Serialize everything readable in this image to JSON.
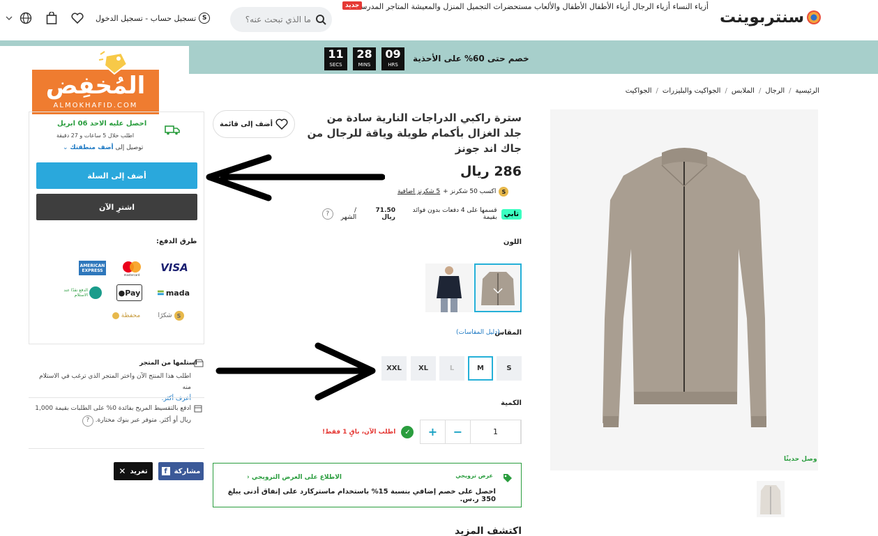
{
  "header": {
    "logo_text": "سنتربوينت",
    "new_badge": "جديد",
    "categories_line": "أزياء النساء أزياء الرجال أزياء الأطفال الأطفال والألعاب مستحضرات التجميل المنزل والمعيشة المتاجر المدرسة",
    "search_placeholder": "ما الذي تبحث عنه؟",
    "signin_label": "تسجيل حساب - تسجيل الدخول",
    "shukran_symbol": "S"
  },
  "promo": {
    "text": "خصم حتى 60% على الأحذية",
    "timer": [
      {
        "value": "09",
        "unit": "HRS"
      },
      {
        "value": "28",
        "unit": "MINS"
      },
      {
        "value": "11",
        "unit": "SECS"
      }
    ]
  },
  "watermark": {
    "arabic": "المُخفِض",
    "latin": "ALMOKHAFID.COM"
  },
  "breadcrumb": [
    "الرئيسية",
    "الرجال",
    "الملابس",
    "الجواكيت والبليزرات",
    "الجواكيت"
  ],
  "breadcrumb_sep": "/",
  "product": {
    "title": "سترة راكبي الدراجات النارية سادة من جلد الغزال بأكمام طويلة وياقة للرجال من جاك اند جونز",
    "wishlist_label": "أضف إلى قائمة",
    "price": "286 ريال",
    "earn_text": "اكسب 50 شكرنز +",
    "earn_extra": "5 شكرنز اضافية",
    "tabby_logo": "تابي",
    "tabby_text": "قسمها على 4 دفعات بدون فوائد بقيمة",
    "tabby_amount": "71.50 ريال",
    "tabby_suffix": "/ الشهر",
    "color_label": "اللون",
    "size_label": "المقاس",
    "size_guide": "(دليل المقاسات)",
    "sizes": [
      "S",
      "M",
      "L",
      "XL",
      "XXL"
    ],
    "quantity_label": "الكمية",
    "quantity": "1",
    "stock_text": "اطلب الآن، باقٍ 1 فقط!",
    "new_arrival": "وصل حديثًا",
    "discover": "اكتشف المزيد"
  },
  "offer": {
    "label": "عرض ترويجي",
    "link": "الاطلاع على العرض الترويجي",
    "desc": "احصل على خصم إضافي بنسبة 15% باستخدام ماستركارد على إنفاق أدنى يبلغ 350 ر.س."
  },
  "delivery": {
    "line1": "احصل عليه الاحد 06 ابريل",
    "line2": "اطلب خلال 5 ساعات و 27 دقيقة",
    "line3_prefix": "توصيل إلى",
    "line3_link": "أضف منطقتك"
  },
  "buttons": {
    "add_to_cart": "أضف إلى السلة",
    "buy_now": "اشترِ الآن"
  },
  "payment": {
    "title": "طرق الدفع:",
    "methods": [
      "VISA",
      "mastercard",
      "AMERICAN EXPRESS",
      "mada",
      "Pay",
      "الدفع نقدًا عند الاستلام",
      "شكرًا",
      "محفظة"
    ]
  },
  "pickup": {
    "title": "استلمها من المتجر",
    "desc": "اطلب هذا المنتج الآن واختر المتجر الذي ترغب في الاستلام منه",
    "link": "أعرف أكثر."
  },
  "installment": {
    "text": "ادفع بالتقسيط المريح بفائدة 0% على الطلبات بقيمة 1,000 ريال أو أكثر. متوفر عبر بنوك مختارة."
  },
  "share": {
    "facebook": "مشاركة",
    "x": "تغريد"
  },
  "colors": {
    "accent": "#25b0d8",
    "promo_band": "#a7cfcb",
    "watermark": "#ef7c30",
    "success": "#2a9d3e",
    "danger": "#e53935"
  }
}
